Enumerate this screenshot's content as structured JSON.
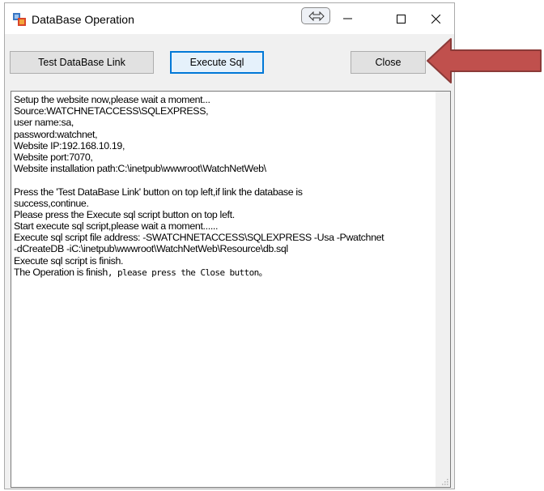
{
  "window": {
    "title": "DataBase Operation",
    "accent_color": "#0078d7"
  },
  "toolbar": {
    "test_label": "Test DataBase Link",
    "execute_label": "Execute Sql",
    "close_label": "Close"
  },
  "log": {
    "lines": [
      "Setup the website now,please wait a moment...",
      "Source:WATCHNETACCESS\\SQLEXPRESS,",
      "user name:sa,",
      "password:watchnet,",
      "Website IP:192.168.10.19,",
      "Website port:7070,",
      "Website installation path:C:\\inetpub\\wwwroot\\WatchNetWeb\\",
      "",
      "Press the 'Test DataBase Link' button on top left,if link the database is",
      "success,continue.",
      "Please press the Execute sql script button on top left.",
      "Start execute sql script,please wait a moment......",
      "Execute sql script file address: -SWATCHNETACCESS\\SQLEXPRESS -Usa -Pwatchnet",
      "-dCreateDB -iC:\\inetpub\\wwwroot\\WatchNetWeb\\Resource\\db.sql",
      "Execute sql script is finish."
    ],
    "last_line_prefix": "The Operation is finish",
    "last_line_suffix": ", please press the Close button。"
  },
  "annotation": {
    "arrow_color": "#c0504d",
    "arrow_outline": "#8b3a38"
  }
}
